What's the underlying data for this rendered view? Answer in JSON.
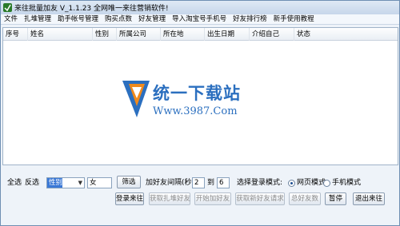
{
  "window": {
    "title": "来往批量加友 V_1.1.23  全网唯一来往营销软件!"
  },
  "menu": [
    "文件",
    "扎堆管理",
    "助手帐号管理",
    "购买点数",
    "好友管理",
    "导入淘宝号手机号",
    "好友排行榜",
    "新手使用教程"
  ],
  "table": {
    "columns": [
      "序号",
      "姓名",
      "性别",
      "所属公司",
      "所在地",
      "出生日期",
      "介绍自己",
      "状态"
    ]
  },
  "watermark": {
    "brand": "统一下载站",
    "url": "Www.3987.Com"
  },
  "controls": {
    "select_all": "全选",
    "invert": "反选",
    "field_select": "性别",
    "filter_value": "女",
    "filter_button": "筛选",
    "interval_label": "加好友间隔(秒)",
    "interval_from": "2",
    "interval_to_label": "到",
    "interval_to": "6",
    "mode_label": "选择登录模式:",
    "mode_web": "网页模式",
    "mode_phone": "手机模式",
    "mode_selected": "网页模式"
  },
  "buttons": {
    "login": "登录来往",
    "get_group_friends": "获取扎堆好友",
    "start_add": "开始加好友",
    "get_new_requests": "获取新好友请求",
    "total_friends": "总好友数",
    "pause": "暂停",
    "exit": "退出来往"
  },
  "colors": {
    "accent": "#2b6fbf",
    "selection": "#3a78d6",
    "window_bg": "#eef3f9"
  }
}
